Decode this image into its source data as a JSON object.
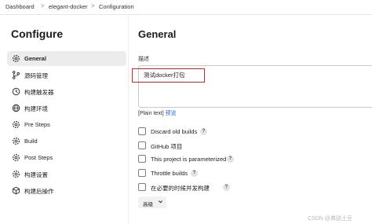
{
  "breadcrumb": {
    "items": [
      "Dashboard",
      "elegant-docker",
      "Configuration"
    ],
    "separator": ">"
  },
  "sidebar": {
    "title": "Configure",
    "items": [
      {
        "label": "General",
        "icon": "gear-icon",
        "active": true
      },
      {
        "label": "源码管理",
        "icon": "source-branch-icon",
        "active": false
      },
      {
        "label": "构建触发器",
        "icon": "clock-icon",
        "active": false
      },
      {
        "label": "构建环境",
        "icon": "globe-icon",
        "active": false
      },
      {
        "label": "Pre Steps",
        "icon": "gear-icon",
        "active": false
      },
      {
        "label": "Build",
        "icon": "gear-icon",
        "active": false
      },
      {
        "label": "Post Steps",
        "icon": "gear-icon",
        "active": false
      },
      {
        "label": "构建设置",
        "icon": "gear-icon",
        "active": false
      },
      {
        "label": "构建后操作",
        "icon": "cube-icon",
        "active": false
      }
    ]
  },
  "main": {
    "title": "General",
    "description_label": "描述",
    "description_value": "测试docker打包",
    "plain_text": "[Plain text]",
    "preview_link": "预览",
    "options": [
      {
        "label": "Discard old builds",
        "help": "?",
        "checked": false
      },
      {
        "label": "GitHub 项目",
        "help": "",
        "checked": false
      },
      {
        "label": "This project is parameterized",
        "help": "?",
        "checked": false
      },
      {
        "label": "Throttle builds",
        "help": "?",
        "checked": false
      },
      {
        "label": "在必要的时候并发构建",
        "help": "?",
        "checked": false
      }
    ],
    "advanced_label": "高级"
  },
  "watermark": "CSDN @弗锐土豆",
  "colors": {
    "highlight_box": "#e0201e",
    "link": "#1f6bd6",
    "active_bg": "#ececec"
  }
}
